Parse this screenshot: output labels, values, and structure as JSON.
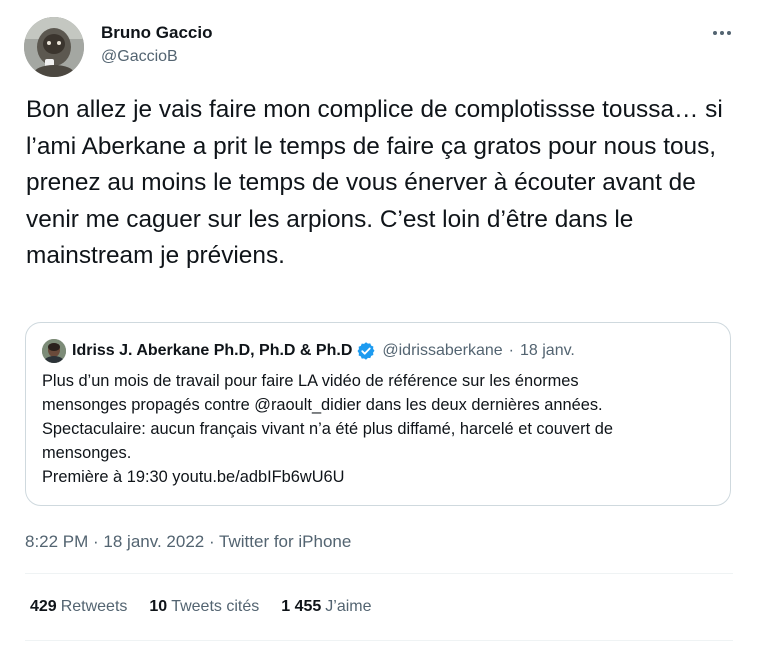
{
  "author": {
    "display_name": "Bruno Gaccio",
    "handle": "@GaccioB"
  },
  "tweet": {
    "text": "Bon allez je vais faire mon complice de complotissse toussa… si l’ami Aberkane a prit le temps de faire ça gratos pour nous tous, prenez au moins le temps de vous énerver à écouter avant de venir me caguer sur les arpions. C’est loin d’être dans le mainstream je préviens."
  },
  "quoted_tweet": {
    "display_name": "Idriss J. Aberkane Ph.D, Ph.D & Ph.D",
    "handle": "@idrissaberkane",
    "separator": "·",
    "date": "18 janv.",
    "body_lines": [
      "Plus d’un mois de travail pour faire LA vidéo de référence sur les énormes",
      "mensonges propagés contre @raoult_didier dans les deux dernières années.",
      "Spectaculaire: aucun français vivant n’a été plus diffamé, harcelé et couvert de",
      "mensonges.",
      "Première à 19:30 youtu.be/adbIFb6wU6U"
    ],
    "verified_color": "#1d9bf0"
  },
  "meta": {
    "timestamp": "8:22 PM · 18 janv. 2022 · Twitter for iPhone"
  },
  "stats": {
    "retweets_count": "429",
    "retweets_label": "Retweets",
    "quotes_count": "10",
    "quotes_label": "Tweets cités",
    "likes_count": "1 455",
    "likes_label": "J’aime"
  },
  "icons": {
    "more": "more-horizontal-icon",
    "verified": "verified-badge-icon"
  }
}
